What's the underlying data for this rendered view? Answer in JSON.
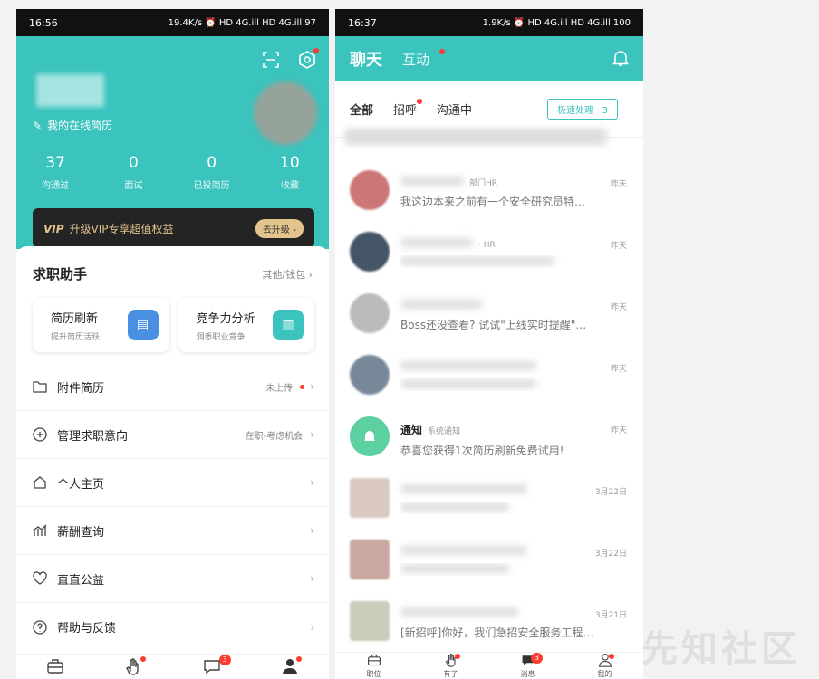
{
  "left_phone": {
    "status": {
      "time": "16:56",
      "right": "19.4K/s ⏰ HD 4G.ill HD 4G.ill 97"
    },
    "resume_link": "我的在线简历",
    "stats": [
      {
        "num": "37",
        "label": "沟通过"
      },
      {
        "num": "0",
        "label": "面试"
      },
      {
        "num": "0",
        "label": "已投简历"
      },
      {
        "num": "10",
        "label": "收藏"
      }
    ],
    "vip": {
      "text": "升级VIP专享超值权益",
      "button": "去升级 ›"
    },
    "assistant": {
      "title": "求职助手",
      "more": "其他/钱包 ›"
    },
    "tools": [
      {
        "title": "简历刷新",
        "sub": "提升简历活跃",
        "color": "#4a90e2"
      },
      {
        "title": "竞争力分析",
        "sub": "洞悉职业竞争",
        "color": "#3bc3bd"
      }
    ],
    "menu": [
      {
        "label": "附件简历",
        "value": "未上传",
        "icon": "folder-icon"
      },
      {
        "label": "管理求职意向",
        "value": "在职-考虑机会",
        "icon": "plus-circle-icon"
      },
      {
        "label": "个人主页",
        "value": "",
        "icon": "home-icon"
      },
      {
        "label": "薪酬查询",
        "value": "",
        "icon": "chart-icon"
      },
      {
        "label": "直直公益",
        "value": "",
        "icon": "heart-icon"
      },
      {
        "label": "帮助与反馈",
        "value": "",
        "icon": "help-icon"
      }
    ],
    "tabs": [
      {
        "label": "职位",
        "icon": "briefcase-icon"
      },
      {
        "label": "有了",
        "icon": "hand-icon"
      },
      {
        "label": "消息",
        "icon": "chat-icon",
        "badge": "3"
      },
      {
        "label": "我的",
        "icon": "user-icon"
      }
    ]
  },
  "right_phone": {
    "status": {
      "time": "16:37",
      "right": "1.9K/s ⏰ HD 4G.ill HD 4G.ill 100"
    },
    "header": {
      "title": "聊天",
      "tab": "互动"
    },
    "subtabs": [
      "全部",
      "招呼",
      "沟通中"
    ],
    "quick": "极速处理 · 3",
    "chats": [
      {
        "name": "",
        "sub": "部门HR",
        "msg": "我这边本来之前有一个安全研究员特…",
        "time": "昨天"
      },
      {
        "name": "",
        "sub": "· HR",
        "msg": "",
        "time": "昨天"
      },
      {
        "name": "",
        "sub": "",
        "msg": "Boss还没查看? 试试\"上线实时提醒\"…",
        "time": "昨天"
      },
      {
        "name": "",
        "sub": "",
        "msg": "",
        "time": "昨天"
      },
      {
        "name": "通知",
        "sub": "系统通知",
        "msg": "恭喜您获得1次简历刷新免费试用!",
        "time": "昨天"
      },
      {
        "name": "",
        "sub": "",
        "msg": "",
        "time": "3月22日"
      },
      {
        "name": "",
        "sub": "",
        "msg": "",
        "time": "3月22日"
      },
      {
        "name": "",
        "sub": "",
        "msg": "[新招呼]你好，我们急招安全服务工程…",
        "time": "3月21日"
      }
    ],
    "tabs": [
      {
        "label": "职位"
      },
      {
        "label": "有了"
      },
      {
        "label": "消息",
        "badge": "3"
      },
      {
        "label": "我的"
      }
    ],
    "watermark": "先知社区"
  }
}
